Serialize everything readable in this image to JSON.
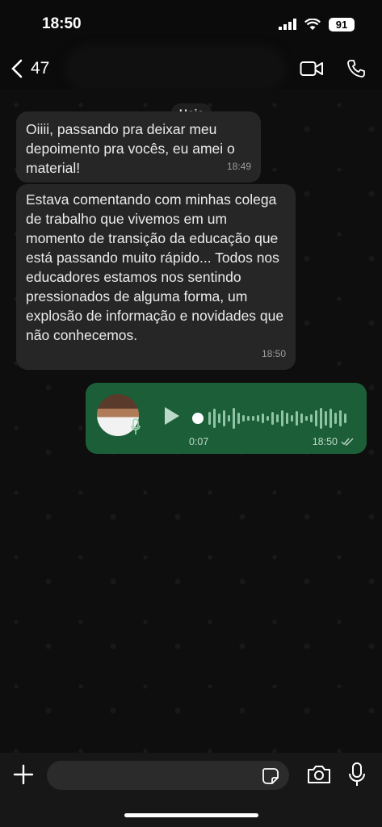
{
  "status_bar": {
    "time": "18:50",
    "battery": "91"
  },
  "header": {
    "unread_count": "47"
  },
  "chat": {
    "day_label": "Hoje",
    "messages": [
      {
        "text": "Oiiii, passando pra deixar meu depoimento pra vocês, eu amei o material!",
        "time": "18:49"
      },
      {
        "text": "Estava comentando com minhas colega de trabalho que vivemos em um momento de transição da educação que está passando muito rápido... Todos nos educadores estamos nos sentindo pressionados de alguma forma, um explosão de informação e novidades que não conhecemos.",
        "time": "18:50"
      }
    ],
    "voice_message": {
      "duration": "0:07",
      "time": "18:50",
      "read_status": "read"
    }
  },
  "colors": {
    "incoming_bubble": "#262626",
    "outgoing_bubble": "#1c5e38",
    "background": "#0e0e0e"
  },
  "icons": [
    "back-chevron-icon",
    "video-call-icon",
    "voice-call-icon",
    "play-icon",
    "mic-badge-icon",
    "double-check-icon",
    "plus-icon",
    "sticker-icon",
    "camera-icon",
    "mic-icon"
  ]
}
